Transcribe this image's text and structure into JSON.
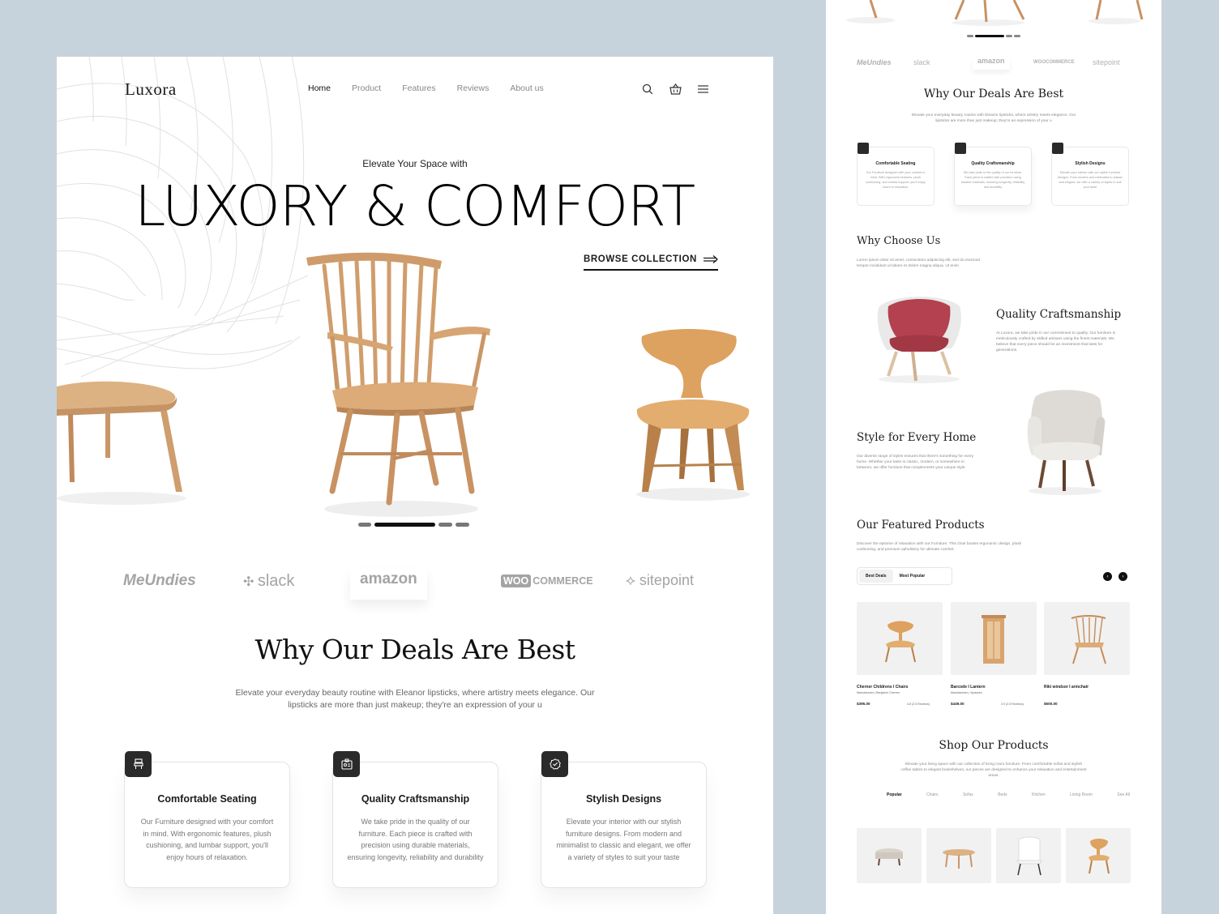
{
  "brand": "Luxora",
  "nav": [
    "Home",
    "Product",
    "Features",
    "Reviews",
    "About us"
  ],
  "hero": {
    "kicker": "Elevate Your Space with",
    "title": "LUXORY & COMFORT",
    "cta": "BROWSE COLLECTION"
  },
  "carousel": {
    "slides": 4,
    "active": 1
  },
  "brands": [
    "MeUndies",
    "slack",
    "amazon",
    "COMMERCE",
    "sitepoint"
  ],
  "woo_mark": "WOO",
  "deals": {
    "title": "Why Our Deals Are Best",
    "subtitle": "Elevate your everyday beauty routine with Eleanor lipsticks, where artistry meets elegance. Our lipsticks are more than just makeup; they're an expression of your u",
    "cards": [
      {
        "title": "Comfortable Seating",
        "text": "Our Furniture designed with your comfort in mind. With ergonomic features, plush cushioning, and lumbar support, you'll enjoy hours of relaxation.",
        "icon": "seat-icon"
      },
      {
        "title": "Quality Craftsmanship",
        "text": "We take pride in the quality of our furniture. Each piece is crafted with precision using durable materials, ensuring longevity, reliability and durability",
        "icon": "badge-icon"
      },
      {
        "title": "Stylish Designs",
        "text": "Elevate your interior with our stylish furniture designs. From modern and minimalist to classic and elegant, we offer a variety of styles to suit your taste",
        "icon": "check-seal-icon"
      }
    ]
  },
  "right": {
    "deals_title": "Why Our Deals Are Best",
    "deals_sub": "Elevate your everyday beauty routine with Eleanor lipsticks, where artistry meets elegance. Our lipsticks are more than just makeup; they're an expression of your u",
    "choose_title": "Why Choose Us",
    "choose_sub": "Lorem ipsum dolor sit amet, consectetur adipiscing elit, sed do eiusmod tempor incididunt ut labore et dolore magna aliqua. Ut enim",
    "quality_title": "Quality Craftsmanship",
    "quality_text": "At Luxora, we take pride in our commitment to quality. Our furniture is meticulously crafted by skilled artisans using the finest materials. We believe that every piece should be an investment that lasts for generations.",
    "style_title": "Style for Every Home",
    "style_text": "Our diverse range of styles ensures that there's something for every home. Whether your taste is classic, modern, or somewhere in between, we offer furniture that complements your unique style.",
    "featured_title": "Our Featured Products",
    "featured_sub": "Discover the epitome of relaxation with our Furniture. This chair boasts ergonomic design, plush cushioning, and premium upholstery for ultimate comfort.",
    "tabs": [
      "Best Deals",
      "Most Popular"
    ],
    "products": [
      {
        "name": "Cherner Childrens I Chairs",
        "maker": "Manufacturer | Benjamin Cherner",
        "price": "$395.00",
        "rating": "4.8 (2.5 Reviews)"
      },
      {
        "name": "Barcode I Lantern",
        "maker": "Manufacturer | Vipassim",
        "price": "$449.00",
        "rating": "4.9 (2.5 Reviews)"
      },
      {
        "name": "Riki windsor I armchair",
        "maker": "",
        "price": "$500.00",
        "rating": ""
      }
    ],
    "shop_title": "Shop Our Products",
    "shop_sub": "Elevate your living space with our collection of living room furniture. From comfortable sofas and stylish coffee tables to elegant bookshelves, our pieces are designed to enhance your relaxation and entertainment areas.",
    "categories": [
      "Popular",
      "Chairs",
      "Sofas",
      "Beds",
      "Kitchen",
      "Living Room",
      "See All"
    ]
  },
  "colors": {
    "background": "#c6d3dc",
    "wood": "#d9a26b",
    "dark": "#2a2a2a",
    "red": "#b3414f"
  }
}
